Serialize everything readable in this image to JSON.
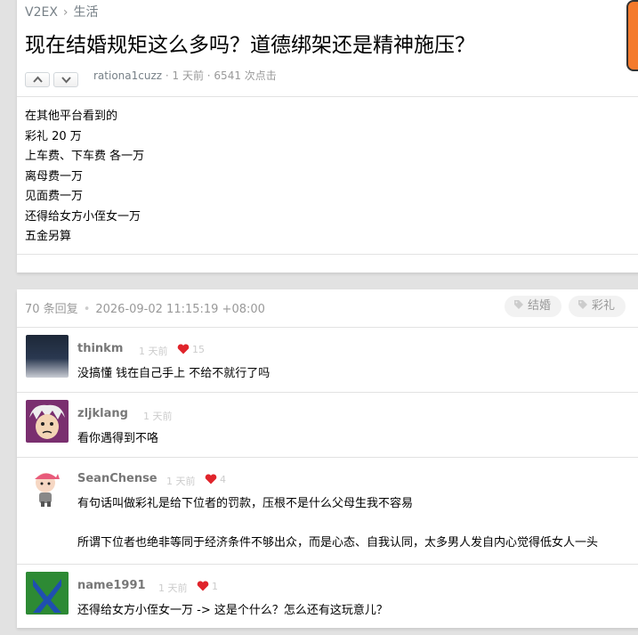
{
  "breadcrumb": {
    "site": "V2EX",
    "separator": "›",
    "node": "生活"
  },
  "topic": {
    "title": "现在结婚规矩这么多吗？道德绑架还是精神施压？",
    "author": "rationa1cuzz",
    "time": "1 天前",
    "clicks": "6541 次点击",
    "content_lines": [
      "在其他平台看到的",
      "彩礼 20 万",
      "上车费、下车费 各一万",
      "离母费一万",
      "见面费一万",
      "还得给女方小侄女一万",
      "五金另算"
    ]
  },
  "replies_header": {
    "count": "70 条回复",
    "datetime": "2026-09-02 11:15:19 +08:00",
    "tags": [
      "结婚",
      "彩礼"
    ]
  },
  "replies": [
    {
      "username": "thinkm",
      "time": "1 天前",
      "likes": "15",
      "text": [
        "没搞懂 钱在自己手上 不给不就行了吗"
      ]
    },
    {
      "username": "zljklang",
      "time": "1 天前",
      "likes": "",
      "text": [
        "看你遇得到不咯"
      ]
    },
    {
      "username": "SeanChense",
      "time": "1 天前",
      "likes": "4",
      "text": [
        "有句话叫做彩礼是给下位者的罚款，压根不是什么父母生我不容易",
        "",
        "所谓下位者也绝非等同于经济条件不够出众，而是心态、自我认同，太多男人发自内心觉得低女人一头"
      ]
    },
    {
      "username": "name1991",
      "time": "1 天前",
      "likes": "1",
      "text": [
        "还得给女方小侄女一万 -> 这是个什么？怎么还有这玩意儿？"
      ]
    }
  ],
  "colors": {
    "accent": "#f47a2c",
    "heart": "#e0242b",
    "meta": "#999999"
  }
}
